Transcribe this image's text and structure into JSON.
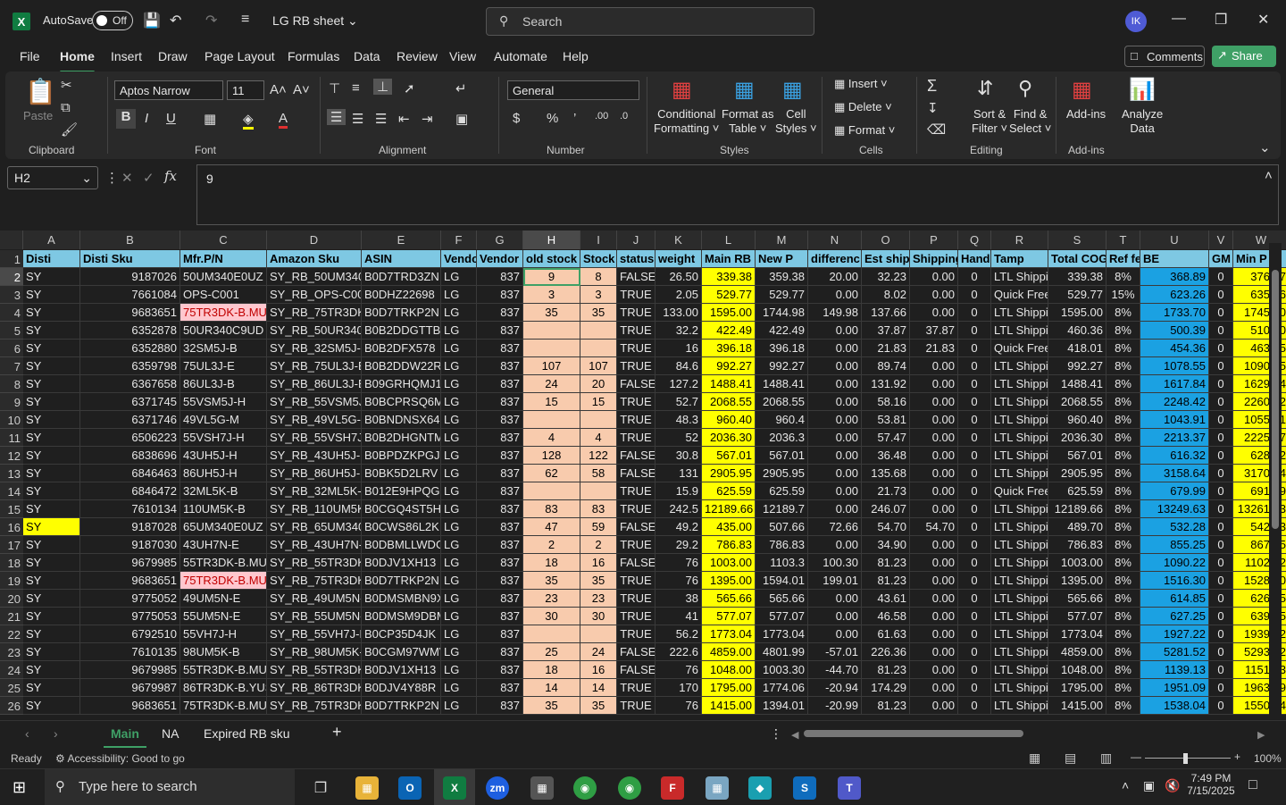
{
  "titlebar": {
    "app_logo": "X",
    "autosave_label": "AutoSave",
    "autosave_state": "Off",
    "doc_name": "LG RB sheet",
    "search_placeholder": "Search",
    "avatar_initials": "IK"
  },
  "menu": [
    "File",
    "Home",
    "Insert",
    "Draw",
    "Page Layout",
    "Formulas",
    "Data",
    "Review",
    "View",
    "Automate",
    "Help"
  ],
  "menu_active": "Home",
  "comments_label": "Comments",
  "share_label": "Share",
  "ribbon": {
    "clipboard": {
      "label": "Clipboard",
      "paste": "Paste"
    },
    "font": {
      "label": "Font",
      "name": "Aptos Narrow",
      "size": "11"
    },
    "alignment": {
      "label": "Alignment"
    },
    "number": {
      "label": "Number",
      "format": "General"
    },
    "styles": {
      "label": "Styles",
      "conditional": "Conditional",
      "formatting": "Formatting",
      "format_as": "Format as",
      "table": "Table",
      "cell": "Cell",
      "styles_btn": "Styles"
    },
    "cells": {
      "label": "Cells",
      "insert": "Insert",
      "delete": "Delete",
      "format": "Format"
    },
    "editing": {
      "label": "Editing",
      "sort": "Sort &",
      "filter": "Filter",
      "find": "Find &",
      "select": "Select"
    },
    "addins": {
      "label": "Add-ins",
      "addins_btn": "Add-ins",
      "analyze": "Analyze",
      "data": "Data"
    }
  },
  "formula": {
    "name_box": "H2",
    "value": "9"
  },
  "columns": [
    "A",
    "B",
    "C",
    "D",
    "E",
    "F",
    "G",
    "H",
    "I",
    "J",
    "K",
    "L",
    "M",
    "N",
    "O",
    "P",
    "Q",
    "R",
    "S",
    "T",
    "U",
    "V",
    "W",
    "G"
  ],
  "headers": [
    "Disti",
    "Disti Sku",
    "Mfr.P/N",
    "Amazon Sku",
    "ASIN",
    "Vendo",
    "Vendor",
    "old stock",
    "Stock",
    "status",
    "weight",
    "Main RB I",
    "New P",
    "differenc",
    "Est ship",
    "Shipping",
    "Handl",
    "Tamp",
    "Total COG",
    "Ref fe",
    "BE",
    "GM",
    "Min P",
    ""
  ],
  "rows": [
    [
      "SY",
      "9187026",
      "50UM340E0UZ",
      "SY_RB_50UM340E",
      "B0D7TRD3ZN",
      "LG",
      "837",
      "9",
      "8",
      "FALSE",
      "26.50",
      "339.38",
      "359.38",
      "20.00",
      "32.23",
      "0.00",
      "0",
      "LTL Shippi",
      "339.38",
      "8%",
      "368.89",
      "0",
      "376.27",
      ""
    ],
    [
      "SY",
      "7661084",
      "OPS-C001",
      "SY_RB_OPS-C001",
      "B0DHZ22698",
      "LG",
      "837",
      "3",
      "3",
      "TRUE",
      "2.05",
      "529.77",
      "529.77",
      "0.00",
      "8.02",
      "0.00",
      "0",
      "Quick Free",
      "529.77",
      "15%",
      "623.26",
      "0",
      "635.26",
      ""
    ],
    [
      "SY",
      "9683651",
      "75TR3DK-B.MUS",
      "SY_RB_75TR3DK-B",
      "B0D7TRKP2N",
      "LG",
      "837",
      "35",
      "35",
      "TRUE",
      "133.00",
      "1595.00",
      "1744.98",
      "149.98",
      "137.66",
      "0.00",
      "0",
      "LTL Shippi",
      "1595.00",
      "8%",
      "1733.70",
      "0",
      "1745.70",
      ""
    ],
    [
      "SY",
      "6352878",
      "50UR340C9UD",
      "SY_RB_50UR340C",
      "B0B2DDGTTB",
      "LG",
      "837",
      "",
      "",
      "TRUE",
      "32.2",
      "422.49",
      "422.49",
      "0.00",
      "37.87",
      "37.87",
      "0",
      "LTL Shippi",
      "460.36",
      "8%",
      "500.39",
      "0",
      "510.40",
      ""
    ],
    [
      "SY",
      "6352880",
      "32SM5J-B",
      "SY_RB_32SM5J-B",
      "B0B2DFX578",
      "LG",
      "837",
      "",
      "",
      "TRUE",
      "16",
      "396.18",
      "396.18",
      "0.00",
      "21.83",
      "21.83",
      "0",
      "Quick Free",
      "418.01",
      "8%",
      "454.36",
      "0",
      "463.45",
      ""
    ],
    [
      "SY",
      "6359798",
      "75UL3J-E",
      "SY_RB_75UL3J-E",
      "B0B2DDW22R",
      "LG",
      "837",
      "107",
      "107",
      "TRUE",
      "84.6",
      "992.27",
      "992.27",
      "0.00",
      "89.74",
      "0.00",
      "0",
      "LTL Shippi",
      "992.27",
      "8%",
      "1078.55",
      "0",
      "1090.55",
      ""
    ],
    [
      "SY",
      "6367658",
      "86UL3J-B",
      "SY_RB_86UL3J-B",
      "B09GRHQMJ1",
      "LG",
      "837",
      "24",
      "20",
      "FALSE",
      "127.2",
      "1488.41",
      "1488.41",
      "0.00",
      "131.92",
      "0.00",
      "0",
      "LTL Shippi",
      "1488.41",
      "8%",
      "1617.84",
      "0",
      "1629.84",
      ""
    ],
    [
      "SY",
      "6371745",
      "55VSM5J-H",
      "SY_RB_55VSM5J-H",
      "B0BCPRSQ6M",
      "LG",
      "837",
      "15",
      "15",
      "TRUE",
      "52.7",
      "2068.55",
      "2068.55",
      "0.00",
      "58.16",
      "0.00",
      "0",
      "LTL Shippi",
      "2068.55",
      "8%",
      "2248.42",
      "0",
      "2260.42",
      ""
    ],
    [
      "SY",
      "6371746",
      "49VL5G-M",
      "SY_RB_49VL5G-M",
      "B0BNDNSX64",
      "LG",
      "837",
      "",
      "",
      "TRUE",
      "48.3",
      "960.40",
      "960.4",
      "0.00",
      "53.81",
      "0.00",
      "0",
      "LTL Shippi",
      "960.40",
      "8%",
      "1043.91",
      "0",
      "1055.91",
      ""
    ],
    [
      "SY",
      "6506223",
      "55VSH7J-H",
      "SY_RB_55VSH7J-H",
      "B0B2DHGNTM",
      "LG",
      "837",
      "4",
      "4",
      "TRUE",
      "52",
      "2036.30",
      "2036.3",
      "0.00",
      "57.47",
      "0.00",
      "0",
      "LTL Shippi",
      "2036.30",
      "8%",
      "2213.37",
      "0",
      "2225.37",
      ""
    ],
    [
      "SY",
      "6838696",
      "43UH5J-H",
      "SY_RB_43UH5J-H",
      "B0BPDZKPGJ",
      "LG",
      "837",
      "128",
      "122",
      "FALSE",
      "30.8",
      "567.01",
      "567.01",
      "0.00",
      "36.48",
      "0.00",
      "0",
      "LTL Shippi",
      "567.01",
      "8%",
      "616.32",
      "0",
      "628.32",
      ""
    ],
    [
      "SY",
      "6846463",
      "86UH5J-H",
      "SY_RB_86UH5J-H",
      "B0BK5D2LRV",
      "LG",
      "837",
      "62",
      "58",
      "FALSE",
      "131",
      "2905.95",
      "2905.95",
      "0.00",
      "135.68",
      "0.00",
      "0",
      "LTL Shippi",
      "2905.95",
      "8%",
      "3158.64",
      "0",
      "3170.64",
      ""
    ],
    [
      "SY",
      "6846472",
      "32ML5K-B",
      "SY_RB_32ML5K-B",
      "B012E9HPQG",
      "LG",
      "837",
      "",
      "",
      "TRUE",
      "15.9",
      "625.59",
      "625.59",
      "0.00",
      "21.73",
      "0.00",
      "0",
      "Quick Free",
      "625.59",
      "8%",
      "679.99",
      "0",
      "691.99",
      ""
    ],
    [
      "SY",
      "7610134",
      "110UM5K-B",
      "SY_RB_110UM5K-B",
      "B0CGQ4ST5H",
      "LG",
      "837",
      "83",
      "83",
      "TRUE",
      "242.5",
      "12189.66",
      "12189.7",
      "0.00",
      "246.07",
      "0.00",
      "0",
      "LTL Shippi",
      "12189.66",
      "8%",
      "13249.63",
      "0",
      "13261.63",
      ""
    ],
    [
      "SY",
      "9187028",
      "65UM340E0UZ",
      "SY_RB_65UM340E",
      "B0CWS86L2K",
      "LG",
      "837",
      "47",
      "59",
      "FALSE",
      "49.2",
      "435.00",
      "507.66",
      "72.66",
      "54.70",
      "54.70",
      "0",
      "LTL Shippi",
      "489.70",
      "8%",
      "532.28",
      "0",
      "542.93",
      ""
    ],
    [
      "SY",
      "9187030",
      "43UH7N-E",
      "SY_RB_43UH7N-E",
      "B0DBMLLWDG",
      "LG",
      "837",
      "2",
      "2",
      "TRUE",
      "29.2",
      "786.83",
      "786.83",
      "0.00",
      "34.90",
      "0.00",
      "0",
      "LTL Shippi",
      "786.83",
      "8%",
      "855.25",
      "0",
      "867.25",
      ""
    ],
    [
      "SY",
      "9679985",
      "55TR3DK-B.MUS",
      "SY_RB_55TR3DK-B",
      "B0DJV1XH13",
      "LG",
      "837",
      "18",
      "16",
      "FALSE",
      "76",
      "1003.00",
      "1103.3",
      "100.30",
      "81.23",
      "0.00",
      "0",
      "LTL Shippi",
      "1003.00",
      "8%",
      "1090.22",
      "0",
      "1102.22",
      ""
    ],
    [
      "SY",
      "9683651",
      "75TR3DK-B.MUS",
      "SY_RB_75TR3DK-B",
      "B0D7TRKP2N",
      "LG",
      "837",
      "35",
      "35",
      "TRUE",
      "76",
      "1395.00",
      "1594.01",
      "199.01",
      "81.23",
      "0.00",
      "0",
      "LTL Shippi",
      "1395.00",
      "8%",
      "1516.30",
      "0",
      "1528.30",
      ""
    ],
    [
      "SY",
      "9775052",
      "49UM5N-E",
      "SY_RB_49UM5N-E",
      "B0DMSMBN9X",
      "LG",
      "837",
      "23",
      "23",
      "TRUE",
      "38",
      "565.66",
      "565.66",
      "0.00",
      "43.61",
      "0.00",
      "0",
      "LTL Shippi",
      "565.66",
      "8%",
      "614.85",
      "0",
      "626.85",
      ""
    ],
    [
      "SY",
      "9775053",
      "55UM5N-E",
      "SY_RB_55UM5N-E",
      "B0DMSM9DBM",
      "LG",
      "837",
      "30",
      "30",
      "TRUE",
      "41",
      "577.07",
      "577.07",
      "0.00",
      "46.58",
      "0.00",
      "0",
      "LTL Shippi",
      "577.07",
      "8%",
      "627.25",
      "0",
      "639.25",
      ""
    ],
    [
      "SY",
      "6792510",
      "55VH7J-H",
      "SY_RB_55VH7J-H",
      "B0CP35D4JK",
      "LG",
      "837",
      "",
      "",
      "TRUE",
      "56.2",
      "1773.04",
      "1773.04",
      "0.00",
      "61.63",
      "0.00",
      "0",
      "LTL Shippi",
      "1773.04",
      "8%",
      "1927.22",
      "0",
      "1939.22",
      ""
    ],
    [
      "SY",
      "7610135",
      "98UM5K-B",
      "SY_RB_98UM5K-B",
      "B0CGM97WMV",
      "LG",
      "837",
      "25",
      "24",
      "FALSE",
      "222.6",
      "4859.00",
      "4801.99",
      "-57.01",
      "226.36",
      "0.00",
      "0",
      "LTL Shippi",
      "4859.00",
      "8%",
      "5281.52",
      "0",
      "5293.52",
      ""
    ],
    [
      "SY",
      "9679985",
      "55TR3DK-B.MUS",
      "SY_RB_55TR3DK-B",
      "B0DJV1XH13",
      "LG",
      "837",
      "18",
      "16",
      "FALSE",
      "76",
      "1048.00",
      "1003.30",
      "-44.70",
      "81.23",
      "0.00",
      "0",
      "LTL Shippi",
      "1048.00",
      "8%",
      "1139.13",
      "0",
      "1151.13",
      ""
    ],
    [
      "SY",
      "9679987",
      "86TR3DK-B.YUS",
      "SY_RB_86TR3DK-B",
      "B0DJV4Y88R",
      "LG",
      "837",
      "14",
      "14",
      "TRUE",
      "170",
      "1795.00",
      "1774.06",
      "-20.94",
      "174.29",
      "0.00",
      "0",
      "LTL Shippi",
      "1795.00",
      "8%",
      "1951.09",
      "0",
      "1963.09",
      ""
    ],
    [
      "SY",
      "9683651",
      "75TR3DK-B.MUS",
      "SY_RB_75TR3DK-B",
      "B0D7TRKP2N",
      "LG",
      "837",
      "35",
      "35",
      "TRUE",
      "76",
      "1415.00",
      "1394.01",
      "-20.99",
      "81.23",
      "0.00",
      "0",
      "LTL Shippi",
      "1415.00",
      "8%",
      "1538.04",
      "0",
      "1550.04",
      ""
    ]
  ],
  "sheets": [
    "Main",
    "NA",
    "Expired RB sku"
  ],
  "active_sheet": "Main",
  "status": {
    "ready": "Ready",
    "accessibility": "Accessibility: Good to go",
    "zoom": "100%"
  },
  "taskbar": {
    "search_placeholder": "Type here to search",
    "time": "7:49 PM",
    "date": "7/15/2025"
  }
}
